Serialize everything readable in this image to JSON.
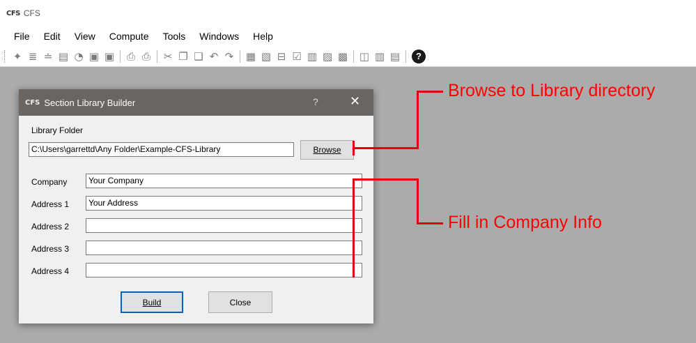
{
  "app": {
    "logo": "CFS",
    "title": "CFS"
  },
  "menu": [
    "File",
    "Edit",
    "View",
    "Compute",
    "Tools",
    "Windows",
    "Help"
  ],
  "toolbar": {
    "groups": [
      [
        {
          "name": "new-section-icon",
          "glyph": "✦"
        },
        {
          "name": "grid-section-icon",
          "glyph": "≣"
        },
        {
          "name": "shape-section-icon",
          "glyph": "≐"
        },
        {
          "name": "open-folder-icon",
          "glyph": "▤"
        },
        {
          "name": "open-recent-icon",
          "glyph": "◔"
        },
        {
          "name": "save-icon",
          "glyph": "▣"
        },
        {
          "name": "save-as-icon",
          "glyph": "▣"
        }
      ],
      [
        {
          "name": "print-preview-icon",
          "glyph": "⎙"
        },
        {
          "name": "print-icon",
          "glyph": "⎙"
        }
      ],
      [
        {
          "name": "cut-icon",
          "glyph": "✂"
        },
        {
          "name": "copy-icon",
          "glyph": "❐"
        },
        {
          "name": "paste-icon",
          "glyph": "❑"
        },
        {
          "name": "undo-icon",
          "glyph": "↶"
        },
        {
          "name": "redo-icon",
          "glyph": "↷"
        }
      ],
      [
        {
          "name": "properties-icon",
          "glyph": "▦"
        },
        {
          "name": "edit-properties-icon",
          "glyph": "▧"
        },
        {
          "name": "analysis-icon",
          "glyph": "⊟"
        },
        {
          "name": "check-icon",
          "glyph": "☑"
        },
        {
          "name": "report-icon",
          "glyph": "▥"
        },
        {
          "name": "image-icon",
          "glyph": "▨"
        },
        {
          "name": "graph-icon",
          "glyph": "▩"
        }
      ],
      [
        {
          "name": "cascade-windows-icon",
          "glyph": "◫"
        },
        {
          "name": "tile-vertical-icon",
          "glyph": "▥"
        },
        {
          "name": "tile-horizontal-icon",
          "glyph": "▤"
        }
      ]
    ],
    "help_glyph": "?"
  },
  "dialog": {
    "logo": "CFS",
    "title": "Section Library Builder",
    "help": "?",
    "close": "✕",
    "library_folder_label": "Library Folder",
    "library_folder_value": "C:\\Users\\garrettd\\Any Folder\\Example-CFS-Library",
    "browse_label": "Browse",
    "fields": [
      {
        "label": "Company",
        "value": "Your Company"
      },
      {
        "label": "Address 1",
        "value": "Your Address"
      },
      {
        "label": "Address 2",
        "value": ""
      },
      {
        "label": "Address 3",
        "value": ""
      },
      {
        "label": "Address 4",
        "value": ""
      }
    ],
    "build_label": "Build",
    "close_label": "Close"
  },
  "annotations": {
    "browse_note": "Browse to Library directory",
    "company_note": "Fill in Company Info",
    "color": "#ff0000"
  }
}
